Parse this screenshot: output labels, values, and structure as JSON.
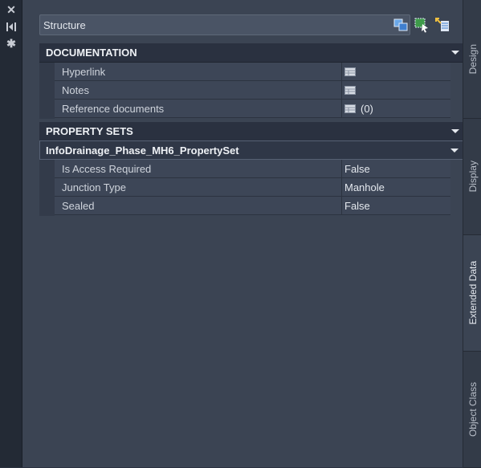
{
  "strip": {
    "close_icon": "close-icon",
    "pin_icon": "collapse-icon",
    "settings_icon": "gear-icon"
  },
  "selector": {
    "value": "Structure"
  },
  "toolbar": {
    "icons": [
      "quick-select-icon",
      "select-objects-icon",
      "pickadd-icon"
    ]
  },
  "documentation": {
    "title": "DOCUMENTATION",
    "rows": [
      {
        "name": "Hyperlink",
        "value": "",
        "icon": "table-icon"
      },
      {
        "name": "Notes",
        "value": "",
        "icon": "table-icon"
      },
      {
        "name": "Reference documents",
        "value": "(0)",
        "icon": "table-icon"
      }
    ]
  },
  "property_sets": {
    "title": "PROPERTY SETS",
    "set_name": "InfoDrainage_Phase_MH6_PropertySet",
    "rows": [
      {
        "name": "Is Access Required",
        "value": "False"
      },
      {
        "name": "Junction Type",
        "value": "Manhole"
      },
      {
        "name": "Sealed",
        "value": "False"
      }
    ]
  },
  "tabs": [
    {
      "label": "Design"
    },
    {
      "label": "Display"
    },
    {
      "label": "Extended Data"
    },
    {
      "label": "Object Class"
    }
  ],
  "colors": {
    "panel_bg": "#3b4453",
    "header_bg": "#2a3140",
    "strip_bg": "#232a35"
  }
}
